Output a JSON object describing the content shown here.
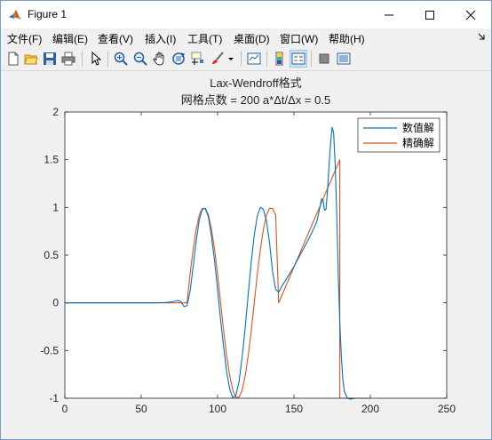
{
  "window": {
    "title": "Figure 1",
    "controls": {
      "minimize": "—",
      "maximize": "☐",
      "close": "✕"
    }
  },
  "menu": {
    "items": [
      "文件(F)",
      "编辑(E)",
      "查看(V)",
      "插入(I)",
      "工具(T)",
      "桌面(D)",
      "窗口(W)",
      "帮助(H)"
    ],
    "overflow_icon": "arrow-icon"
  },
  "toolbar": {
    "icons": [
      "new-figure-icon",
      "open-file-icon",
      "save-icon",
      "print-icon",
      "edit-plot-icon",
      "zoom-in-icon",
      "zoom-out-icon",
      "pan-icon",
      "rotate-3d-icon",
      "data-cursor-icon",
      "brush-icon",
      "brush-dropdown-icon",
      "link-plot-icon",
      "insert-colorbar-icon",
      "insert-legend-icon",
      "hide-plot-tools-icon",
      "show-plot-tools-icon"
    ]
  },
  "chart_data": {
    "type": "line",
    "title": "Lax-Wendroff格式",
    "subtitle": "网格点数 = 200   a*Δt/Δx = 0.5",
    "xlabel": "",
    "ylabel": "",
    "xlim": [
      0,
      250
    ],
    "ylim": [
      -1,
      2
    ],
    "xticks": [
      "0",
      "50",
      "100",
      "150",
      "200",
      "250"
    ],
    "yticks": [
      "-1",
      "-0.5",
      "0",
      "0.5",
      "1",
      "1.5",
      "2"
    ],
    "grid": false,
    "legend_position": "top-right",
    "series": [
      {
        "name": "数值解",
        "color": "#0072bd",
        "x": [
          0,
          60,
          66,
          70,
          74,
          76,
          78,
          80,
          82,
          84,
          86,
          88,
          90,
          92,
          94,
          96,
          98,
          100,
          102,
          104,
          106,
          108,
          110,
          112,
          114,
          116,
          118,
          120,
          122,
          124,
          126,
          128,
          130,
          132,
          134,
          136,
          138,
          140,
          142,
          150,
          160,
          165,
          167,
          168,
          169,
          170,
          171,
          172,
          173,
          174,
          175,
          176,
          177,
          178,
          179,
          180,
          181,
          182,
          183,
          185,
          187,
          190,
          200
        ],
        "y": [
          0,
          0,
          0.003,
          0.01,
          0.025,
          0.015,
          -0.04,
          -0.03,
          0.12,
          0.38,
          0.65,
          0.87,
          0.98,
          0.99,
          0.9,
          0.7,
          0.44,
          0.14,
          -0.18,
          -0.47,
          -0.73,
          -0.91,
          -0.995,
          -0.97,
          -0.83,
          -0.58,
          -0.27,
          0.08,
          0.42,
          0.71,
          0.91,
          1.0,
          0.98,
          0.86,
          0.63,
          0.33,
          0.14,
          0.11,
          0.17,
          0.38,
          0.68,
          0.85,
          1.0,
          1.09,
          1.08,
          0.97,
          0.98,
          1.18,
          1.45,
          1.68,
          1.84,
          1.78,
          1.45,
          0.92,
          0.3,
          -0.2,
          -0.55,
          -0.8,
          -0.93,
          -1.0,
          -1.01,
          -1.0,
          -1.0
        ]
      },
      {
        "name": "精确解",
        "color": "#d95319",
        "x": [
          0,
          80,
          82,
          84,
          86,
          88,
          90,
          92,
          94,
          96,
          98,
          100,
          102,
          104,
          106,
          108,
          110,
          112,
          114,
          116,
          118,
          120,
          122,
          124,
          126,
          128,
          130,
          132,
          134,
          136,
          138,
          140,
          180,
          180.01,
          190,
          200
        ],
        "y": [
          0,
          0,
          0.3,
          0.56,
          0.77,
          0.92,
          0.99,
          0.99,
          0.92,
          0.77,
          0.56,
          0.3,
          0.0,
          -0.3,
          -0.56,
          -0.77,
          -0.92,
          -0.99,
          -0.99,
          -0.92,
          -0.77,
          -0.56,
          -0.3,
          0.0,
          0.3,
          0.56,
          0.77,
          0.92,
          0.99,
          0.99,
          0.92,
          0.0,
          1.5,
          -1.0,
          -1.0,
          -1.0
        ]
      }
    ]
  }
}
